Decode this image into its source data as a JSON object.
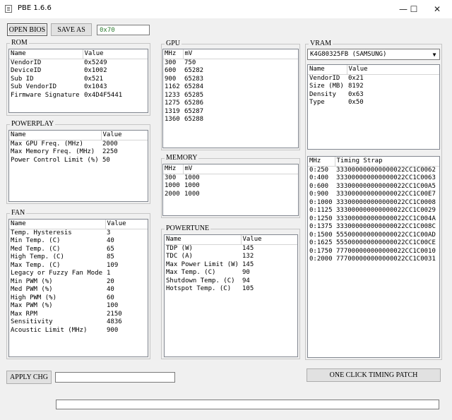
{
  "window": {
    "title": "PBE 1.6.6",
    "minimize_icon": "—",
    "maximize_icon": "☐",
    "close_icon": "✕"
  },
  "toolbar": {
    "open_bios_label": "OPEN BIOS",
    "save_as_label": "SAVE AS",
    "hex_value": "0x70"
  },
  "rom": {
    "title": "ROM",
    "columns": [
      "Name",
      "Value"
    ],
    "rows": [
      [
        "VendorID",
        "0x5249"
      ],
      [
        "DeviceID",
        "0x1002"
      ],
      [
        "Sub ID",
        "0x521"
      ],
      [
        "Sub VendorID",
        "0x1043"
      ],
      [
        "Firmware Signature",
        "0x4D4F5441"
      ]
    ]
  },
  "powerplay": {
    "title": "POWERPLAY",
    "columns": [
      "Name",
      "Value"
    ],
    "rows": [
      [
        "Max GPU Freq. (MHz)",
        "2000"
      ],
      [
        "Max Memory Freq. (MHz)",
        "2250"
      ],
      [
        "Power Control Limit (%)",
        "50"
      ]
    ]
  },
  "fan": {
    "title": "FAN",
    "columns": [
      "Name",
      "Value"
    ],
    "rows": [
      [
        "Temp. Hysteresis",
        "3"
      ],
      [
        "Min Temp. (C)",
        "40"
      ],
      [
        "Med Temp. (C)",
        "65"
      ],
      [
        "High Temp. (C)",
        "85"
      ],
      [
        "Max Temp. (C)",
        "109"
      ],
      [
        "Legacy or Fuzzy Fan Mode",
        "1"
      ],
      [
        "Min PWM (%)",
        "20"
      ],
      [
        "Med PWM (%)",
        "40"
      ],
      [
        "High PWM (%)",
        "60"
      ],
      [
        "Max PWM (%)",
        "100"
      ],
      [
        "Max RPM",
        "2150"
      ],
      [
        "Sensitivity",
        "4836"
      ],
      [
        "Acoustic Limit (MHz)",
        "900"
      ]
    ]
  },
  "gpu": {
    "title": "GPU",
    "columns": [
      "MHz",
      "mV"
    ],
    "rows": [
      [
        "300",
        "750"
      ],
      [
        "600",
        "65282"
      ],
      [
        "900",
        "65283"
      ],
      [
        "1162",
        "65284"
      ],
      [
        "1233",
        "65285"
      ],
      [
        "1275",
        "65286"
      ],
      [
        "1319",
        "65287"
      ],
      [
        "1360",
        "65288"
      ]
    ]
  },
  "memory": {
    "title": "MEMORY",
    "columns": [
      "MHz",
      "mV"
    ],
    "rows": [
      [
        "300",
        "1000"
      ],
      [
        "1000",
        "1000"
      ],
      [
        "2000",
        "1000"
      ]
    ]
  },
  "powertune": {
    "title": "POWERTUNE",
    "columns": [
      "Name",
      "Value"
    ],
    "rows": [
      [
        "TDP (W)",
        "145"
      ],
      [
        "TDC (A)",
        "132"
      ],
      [
        "Max Power Limit (W)",
        "145"
      ],
      [
        "Max Temp. (C)",
        "90"
      ],
      [
        "Shutdown Temp. (C)",
        "94"
      ],
      [
        "Hotspot Temp. (C)",
        "105"
      ]
    ]
  },
  "vram": {
    "title": "VRAM",
    "selected_module": "K4G80325FB (SAMSUNG)",
    "info_columns": [
      "Name",
      "Value"
    ],
    "info_rows": [
      [
        "VendorID",
        "0x21"
      ],
      [
        "Size (MB)",
        "8192"
      ],
      [
        "Density",
        "0x63"
      ],
      [
        "Type",
        "0x50"
      ]
    ],
    "strap_columns": [
      "MHz",
      "Timing Strap"
    ],
    "strap_rows": [
      [
        "0:250",
        "333000000000000022CC1C0062"
      ],
      [
        "0:400",
        "333000000000000022CC1C0063"
      ],
      [
        "0:600",
        "333000000000000022CC1C00A5"
      ],
      [
        "0:900",
        "333000000000000022CC1C00E7"
      ],
      [
        "0:1000",
        "333000000000000022CC1C0008"
      ],
      [
        "0:1125",
        "333000000000000022CC1C0029"
      ],
      [
        "0:1250",
        "333000000000000022CC1C004A"
      ],
      [
        "0:1375",
        "333000000000000022CC1C008C"
      ],
      [
        "0:1500",
        "555000000000000022CC1C00AD"
      ],
      [
        "0:1625",
        "555000000000000022CC1C00CE"
      ],
      [
        "0:1750",
        "777000000000000022CC1C0010"
      ],
      [
        "0:2000",
        "777000000000000022CC1C0031"
      ]
    ]
  },
  "bottom": {
    "apply_label": "APPLY CHG",
    "one_click_label": "ONE CLICK TIMING PATCH"
  }
}
